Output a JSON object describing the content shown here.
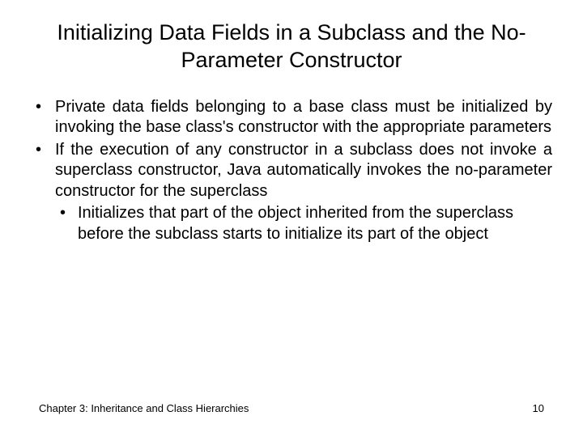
{
  "title": "Initializing Data Fields in a Subclass and the No-Parameter Constructor",
  "bullets": [
    {
      "text": "Private data fields belonging to a base class must be initialized by invoking the base class's constructor with the appropriate parameters",
      "sub": []
    },
    {
      "text": "If the execution of any constructor in a subclass does not invoke a superclass constructor, Java automatically invokes the no-parameter constructor for the superclass",
      "sub": [
        "Initializes that part of the object inherited from the superclass before the subclass starts to initialize its part of the object"
      ]
    }
  ],
  "footer": {
    "chapter": "Chapter 3: Inheritance and Class Hierarchies",
    "page": "10"
  }
}
